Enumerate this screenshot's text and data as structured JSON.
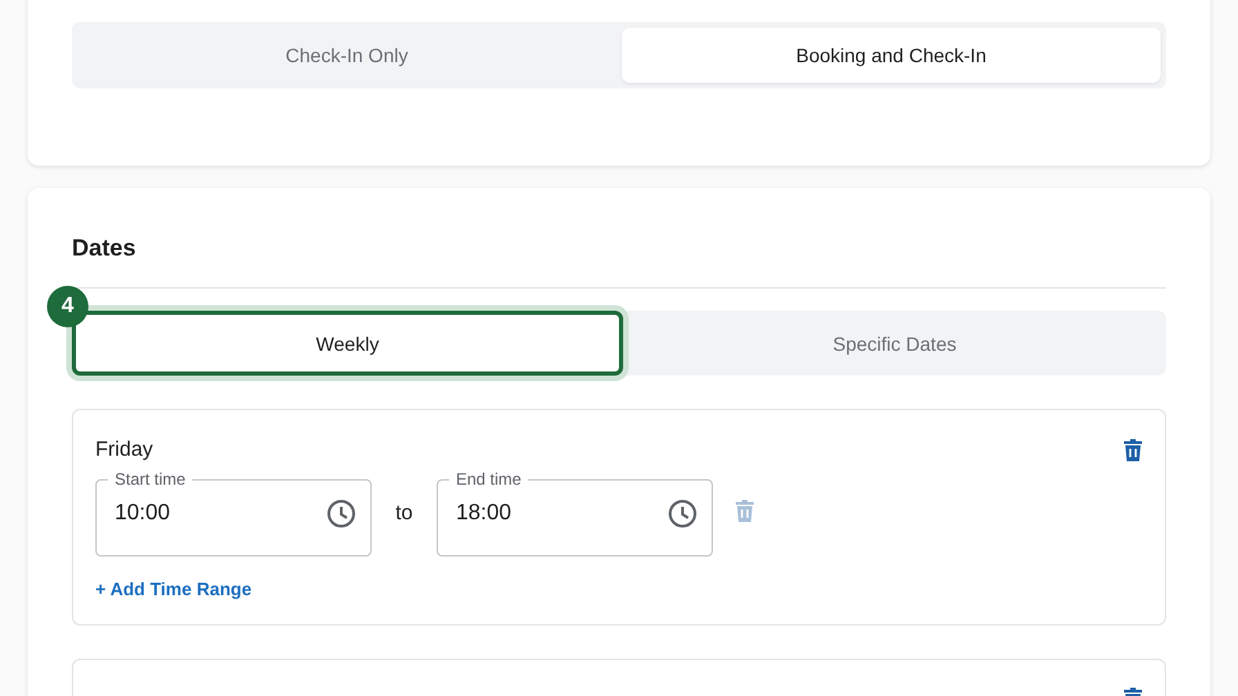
{
  "mode_tabs": [
    {
      "label": "Check-In Only",
      "selected": false
    },
    {
      "label": "Booking and Check-In",
      "selected": true
    }
  ],
  "dates": {
    "title": "Dates",
    "step_badge": "4",
    "tabs": [
      {
        "label": "Weekly",
        "selected": true
      },
      {
        "label": "Specific Dates",
        "selected": false
      }
    ],
    "days": [
      {
        "name": "Friday",
        "ranges": [
          {
            "start": {
              "label": "Start time",
              "value": "10:00"
            },
            "separator": "to",
            "end": {
              "label": "End time",
              "value": "18:00"
            },
            "delete_disabled": true
          }
        ],
        "add_label": "+ Add Time Range",
        "deletable": true
      },
      {
        "deletable": true
      }
    ]
  }
}
